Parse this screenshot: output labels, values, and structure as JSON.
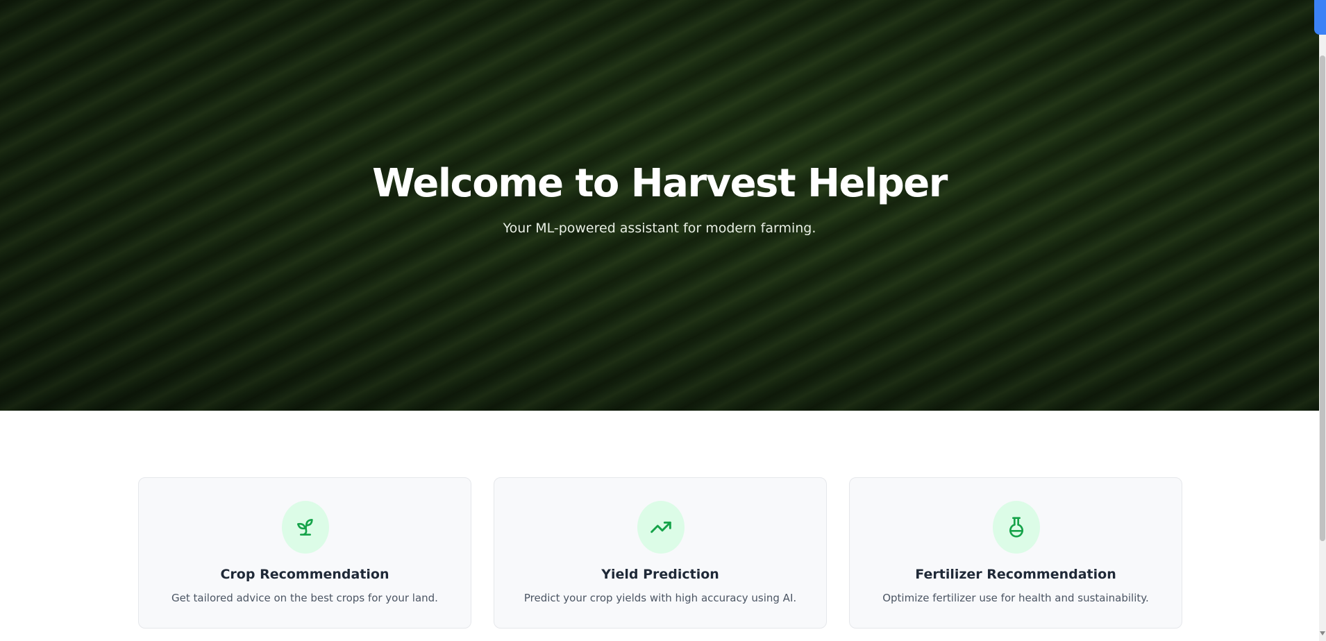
{
  "hero": {
    "title": "Welcome to Harvest Helper",
    "subtitle": "Your ML-powered assistant for modern farming."
  },
  "features": [
    {
      "icon": "sprout-icon",
      "title": "Crop Recommendation",
      "description": "Get tailored advice on the best crops for your land."
    },
    {
      "icon": "trending-up-icon",
      "title": "Yield Prediction",
      "description": "Predict your crop yields with high accuracy using AI."
    },
    {
      "icon": "flask-icon",
      "title": "Fertilizer Recommendation",
      "description": "Optimize fertilizer use for health and sustainability."
    }
  ],
  "colors": {
    "accent": "#16a34a",
    "icon_bg": "#dcfce7",
    "card_bg": "#f8f9fb",
    "card_border": "#e5e7eb",
    "title_text": "#1f2937",
    "body_text": "#4b5563"
  }
}
